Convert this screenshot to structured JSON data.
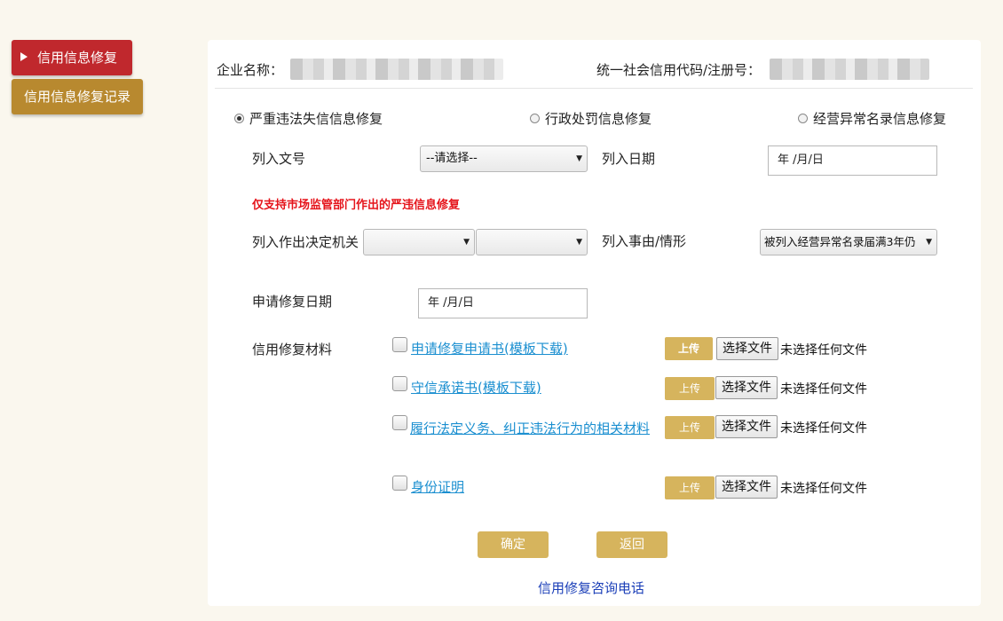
{
  "sidebar": {
    "active_label": "信用信息修复",
    "record_label": "信用信息修复记录"
  },
  "header": {
    "company_label": "企业名称：",
    "code_label": "统一社会信用代码/注册号："
  },
  "repair_types": [
    {
      "label": "严重违法失信信息修复",
      "selected": true
    },
    {
      "label": "行政处罚信息修复",
      "selected": false
    },
    {
      "label": "经营异常名录信息修复",
      "selected": false
    }
  ],
  "form": {
    "doc_no_label": "列入文号",
    "doc_no_select": "--请选择--",
    "list_date_label": "列入日期",
    "list_date_value": "年 /月/日",
    "warning": "仅支持市场监管部门作出的严违信息修复",
    "authority_label": "列入作出决定机关",
    "authority_select_1": "",
    "authority_select_2": "",
    "reason_label": "列入事由/情形",
    "reason_select": "被列入经营异常名录届满3年仍",
    "apply_date_label": "申请修复日期",
    "apply_date_value": "年 /月/日",
    "materials_label": "信用修复材料"
  },
  "materials": [
    {
      "link": "申请修复申请书(模板下载)",
      "upload": "上传",
      "choose": "选择文件",
      "status": "未选择任何文件"
    },
    {
      "link": "守信承诺书(模板下载)",
      "upload": "上传",
      "choose": "选择文件",
      "status": "未选择任何文件"
    },
    {
      "link": "履行法定义务、纠正违法行为的相关材料",
      "upload": "上传",
      "choose": "选择文件",
      "status": "未选择任何文件"
    },
    {
      "link": "身份证明",
      "upload": "上传",
      "choose": "选择文件",
      "status": "未选择任何文件"
    }
  ],
  "actions": {
    "confirm": "确定",
    "back": "返回",
    "consult": "信用修复咨询电话"
  },
  "colors": {
    "sidebar_active": "#c0282d",
    "sidebar_normal": "#b8892f",
    "gold_button": "#d6b45d",
    "warning": "#e5141b",
    "link": "#1b8fd0"
  }
}
